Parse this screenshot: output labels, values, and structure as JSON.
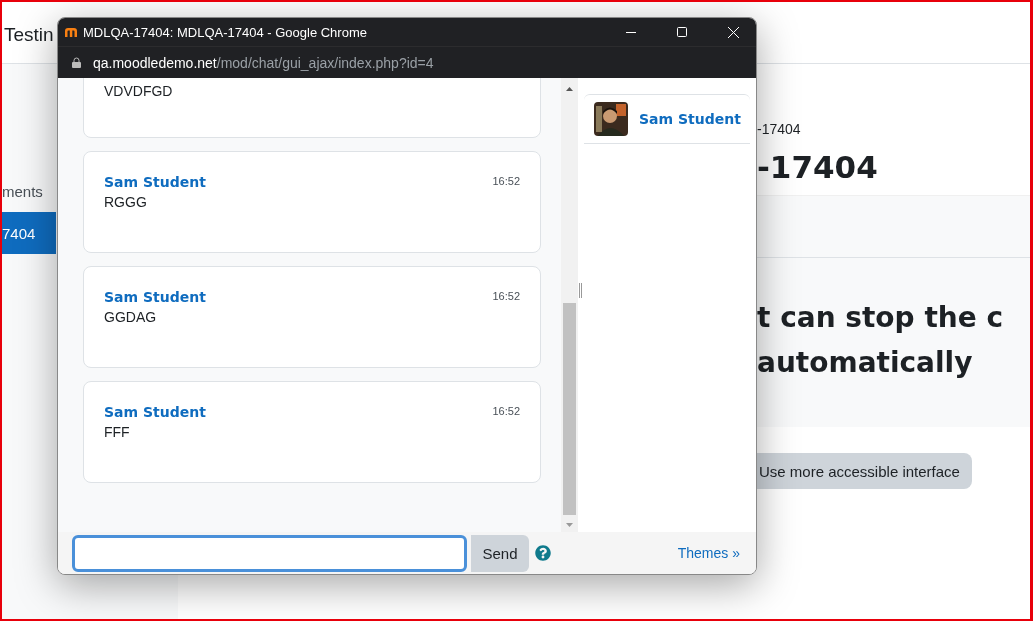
{
  "browser_page": {
    "header_title": "Testin",
    "nav_items": [
      {
        "label": "ments",
        "selected": false
      },
      {
        "label": "7404",
        "selected": true
      }
    ],
    "breadcrumb": "-17404",
    "heading": "-17404",
    "banner_lines": [
      "t can stop the c",
      "automatically"
    ],
    "accessible_button": "Use more accessible interface"
  },
  "popup": {
    "title": "MDLQA-17404: MDLQA-17404 - Google Chrome",
    "url_host": "qa.moodledemo.net",
    "url_path": "/mod/chat/gui_ajax/index.php?id=4",
    "messages": [
      {
        "text": "VDVDFGD"
      },
      {
        "name": "Sam Student",
        "text": "RGGG",
        "time": "16:52"
      },
      {
        "name": "Sam Student",
        "text": "GGDAG",
        "time": "16:52"
      },
      {
        "name": "Sam Student",
        "text": "FFF",
        "time": "16:52"
      }
    ],
    "users": [
      {
        "name": "Sam Student"
      }
    ],
    "send_button": "Send",
    "themes_link": "Themes »"
  }
}
